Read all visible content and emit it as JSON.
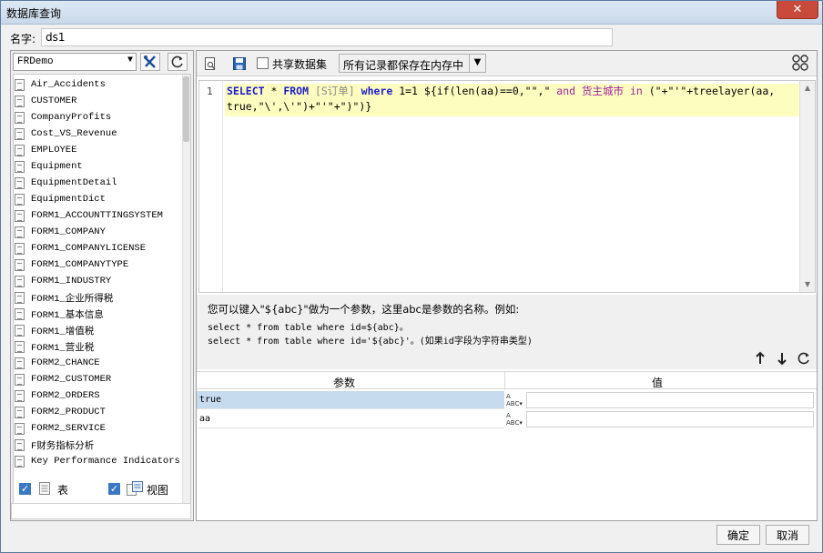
{
  "window": {
    "title": "数据库查询",
    "close_glyph": "✕"
  },
  "name_field": {
    "label": "名字:",
    "value": "ds1"
  },
  "left": {
    "db_select": "FRDemo",
    "tables": [
      "Air_Accidents",
      "CUSTOMER",
      "CompanyProfits",
      "Cost_VS_Revenue",
      "EMPLOYEE",
      "Equipment",
      "EquipmentDetail",
      "EquipmentDict",
      "FORM1_ACCOUNTTINGSYSTEM",
      "FORM1_COMPANY",
      "FORM1_COMPANYLICENSE",
      "FORM1_COMPANYTYPE",
      "FORM1_INDUSTRY",
      "FORM1_企业所得税",
      "FORM1_基本信息",
      "FORM1_增值税",
      "FORM1_营业税",
      "FORM2_CHANCE",
      "FORM2_CUSTOMER",
      "FORM2_ORDERS",
      "FORM2_PRODUCT",
      "FORM2_SERVICE",
      "F财务指标分析",
      "Key Performance Indicators"
    ],
    "check_table_label": "表",
    "check_view_label": "视图"
  },
  "right": {
    "share_label": "共享数据集",
    "mem_select": "所有记录都保存在内存中",
    "sql": {
      "line_no": "1",
      "p1": "SELECT",
      "p2": " * ",
      "p3": "FROM",
      "p4": " [S订单] ",
      "p5": "where",
      "p6": " 1=1 ${if(len(aa)==0,\"\",\" ",
      "p7": "and",
      "p8": " 货主城市 ",
      "p9": "in",
      "p10": " (\"+\"'\"+treelayer(aa,",
      "line2": "true,\"\\',\\'\")+\"'\"+\")\")}"
    },
    "help": {
      "line1": "您可以键入\"${abc}\"做为一个参数，这里abc是参数的名称。例如:",
      "line2": "select * from table where id=${abc}。",
      "line3": "select * from table where id='${abc}'。(如果id字段为字符串类型)"
    },
    "params": {
      "col_param": "参数",
      "col_value": "值",
      "rows": [
        {
          "name": "true",
          "value": ""
        },
        {
          "name": "aa",
          "value": ""
        }
      ]
    }
  },
  "buttons": {
    "ok": "确定",
    "cancel": "取消"
  }
}
